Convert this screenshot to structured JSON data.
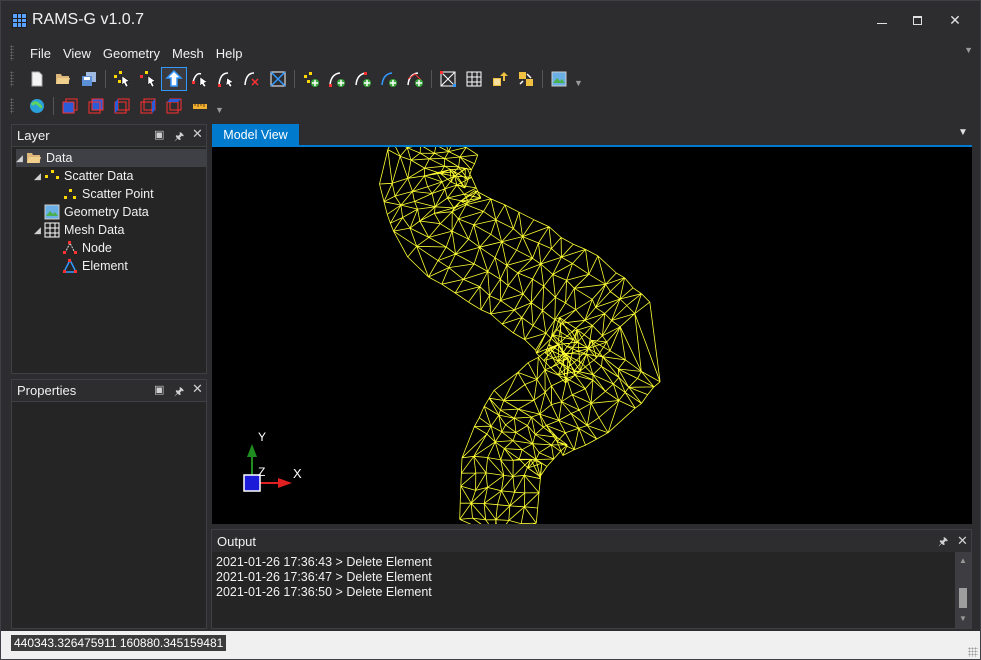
{
  "window": {
    "title": "RAMS-G v1.0.7",
    "minimize_glyph": "",
    "maximize_glyph": "",
    "close_glyph": "✕"
  },
  "menu": {
    "items": [
      "File",
      "View",
      "Geometry",
      "Mesh",
      "Help"
    ]
  },
  "toolbar1": {
    "icons": [
      "new-file-icon",
      "open-folder-icon",
      "save-icon",
      "select-point-icon",
      "deselect-point-icon",
      "select-arrow-icon",
      "select-node-icon",
      "select-arc-icon",
      "select-arc-x-icon",
      "select-mesh-icon",
      "create-point-icon",
      "create-arc-icon",
      "create-arc-b-icon",
      "create-arc-c-icon",
      "create-arc-d-icon",
      "mesh-points-icon",
      "mesh-grid-icon",
      "import-up-icon",
      "export-icon",
      "geometry-image-icon"
    ],
    "active_index": 5
  },
  "toolbar2": {
    "icons": [
      "globe-icon",
      "view-front-icon",
      "view-back-icon",
      "view-left-icon",
      "view-right-icon",
      "view-top-icon",
      "ruler-icon"
    ]
  },
  "layer_panel": {
    "title": "Layer",
    "tree": [
      {
        "label": "Data",
        "level": 0,
        "icon": "folder-open-icon",
        "expanded": true,
        "selected": true
      },
      {
        "label": "Scatter Data",
        "level": 1,
        "icon": "scatter-data-icon",
        "expanded": true
      },
      {
        "label": "Scatter Point",
        "level": 2,
        "icon": "scatter-point-icon"
      },
      {
        "label": "Geometry Data",
        "level": 1,
        "icon": "geometry-data-icon"
      },
      {
        "label": "Mesh Data",
        "level": 1,
        "icon": "mesh-data-icon",
        "expanded": true
      },
      {
        "label": "Node",
        "level": 2,
        "icon": "node-icon"
      },
      {
        "label": "Element",
        "level": 2,
        "icon": "element-icon"
      }
    ]
  },
  "properties_panel": {
    "title": "Properties"
  },
  "model_view": {
    "tab_label": "Model View",
    "axis_labels": {
      "y": "Y",
      "z": "Z",
      "x": "X"
    },
    "mesh_color": "#ffff33"
  },
  "output_panel": {
    "title": "Output",
    "lines": [
      "2021-01-26 17:36:43 > Delete Element",
      "2021-01-26 17:36:47 > Delete Element",
      "2021-01-26 17:36:50 > Delete Element"
    ]
  },
  "status_bar": {
    "coordinates": "440343.326475911 160880.345159481"
  },
  "colors": {
    "accent": "#007acc",
    "background": "#2d2d30",
    "panel": "#252526"
  }
}
